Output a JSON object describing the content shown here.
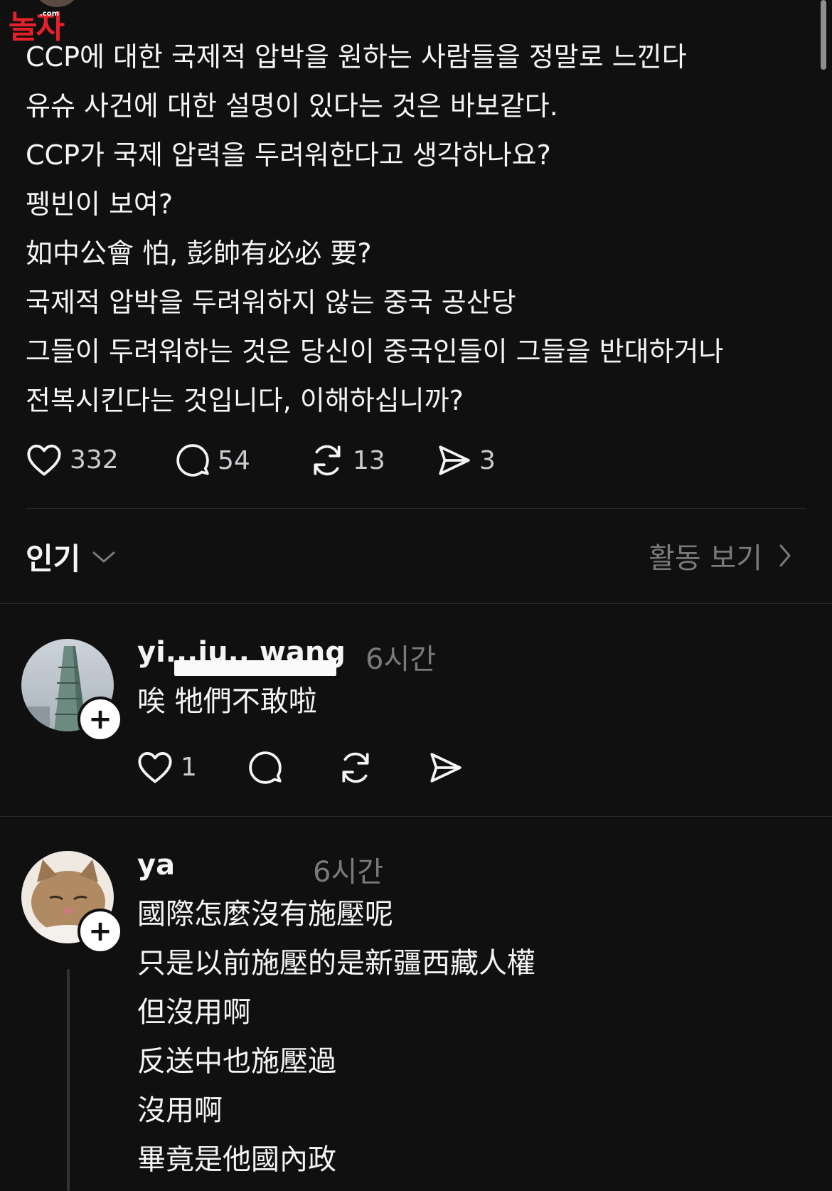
{
  "watermark": {
    "text": "놀자",
    "sub": ".com"
  },
  "post": {
    "lines": [
      "CCP에 대한 국제적 압박을 원하는 사람들을 정말로 느낀다",
      "유슈 사건에 대한 설명이 있다는 것은 바보같다.",
      "CCP가 국제 압력을 두려워한다고 생각하나요?",
      "펭빈이 보여?",
      "如中公會 怕, 彭帥有必必 要?",
      "국제적 압박을 두려워하지 않는 중국 공산당",
      "그들이 두려워하는 것은 당신이 중국인들이 그들을 반대하거나",
      "전복시킨다는 것입니다, 이해하십니까?"
    ],
    "likes": "332",
    "replies": "54",
    "reposts": "13",
    "shares": "3"
  },
  "sort": {
    "label": "인기",
    "activity_label": "활동 보기"
  },
  "comments": [
    {
      "handle": "yi...iu.. wang",
      "time": "6시간",
      "lines": [
        "唉 牠們不敢啦"
      ],
      "likes": "1"
    },
    {
      "handle": "ya",
      "time": "6시간",
      "lines": [
        "國際怎麼沒有施壓呢",
        "只是以前施壓的是新疆西藏人權",
        "但沒用啊",
        "反送中也施壓過",
        "沒用啊",
        "畢竟是他國內政"
      ]
    }
  ],
  "colors": {
    "background": "#101010",
    "text": "#f3f5f7",
    "muted": "#7a7a7a",
    "logo": "#e5202a"
  }
}
